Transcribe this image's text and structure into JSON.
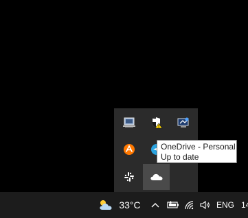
{
  "tray_overflow": {
    "icons": [
      {
        "name": "network-computer-icon"
      },
      {
        "name": "security-shield-warning-icon"
      },
      {
        "name": "display-settings-icon"
      },
      {
        "name": "avast-antivirus-icon"
      },
      {
        "name": "telegram-icon"
      },
      {
        "name": "slack-icon"
      },
      {
        "name": "onedrive-cloud-icon"
      }
    ]
  },
  "tooltip": {
    "title": "OneDrive - Personal",
    "status": "Up to date"
  },
  "taskbar": {
    "weather_temp": "33°C",
    "language": "ENG",
    "clock": "14"
  },
  "colors": {
    "taskbar_bg": "#1c1c1c",
    "flyout_bg": "#2b2b2b",
    "avast_orange": "#ff7800",
    "telegram_blue": "#2aa3e0",
    "shield_warning": "#ffd400"
  }
}
